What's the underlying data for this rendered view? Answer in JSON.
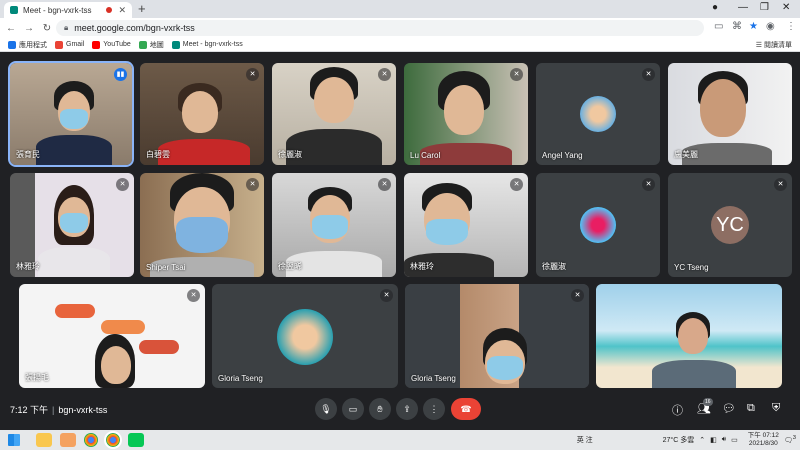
{
  "browser": {
    "tab_title": "Meet - bgn-vxrk-tss",
    "url": "meet.google.com/bgn-vxrk-tss",
    "new_tab_label": "+",
    "bookmarks": [
      {
        "label": "應用程式",
        "icon": "apps-grid-icon",
        "color": "#1a73e8"
      },
      {
        "label": "Gmail",
        "icon": "gmail-icon",
        "color": "#ea4335"
      },
      {
        "label": "YouTube",
        "icon": "youtube-icon",
        "color": "#ff0000"
      },
      {
        "label": "地圖",
        "icon": "maps-icon",
        "color": "#34a853"
      },
      {
        "label": "Meet - bgn-vxrk-tss",
        "icon": "meet-icon",
        "color": "#00897b"
      }
    ],
    "reading_list": "閱讀清單"
  },
  "tiles": [
    {
      "name": "張育民",
      "muted": false,
      "speaking": true
    },
    {
      "name": "白碧雲",
      "muted": true
    },
    {
      "name": "徐麗淑",
      "muted": true
    },
    {
      "name": "Lu Carol",
      "muted": true
    },
    {
      "name": "Angel Yang",
      "muted": true,
      "type": "avatar-photo"
    },
    {
      "name": "盧美麗",
      "muted": false
    },
    {
      "name": "林雅玲",
      "muted": true
    },
    {
      "name": "Shiper Tsai",
      "muted": true
    },
    {
      "name": "徐翌晞",
      "muted": true
    },
    {
      "name": "林雅玲",
      "muted": true
    },
    {
      "name": "徐麗淑",
      "muted": true,
      "type": "avatar-photo"
    },
    {
      "name": "YC Tseng",
      "muted": true,
      "type": "avatar-letter",
      "initials": "YC"
    },
    {
      "name": "張揚毛",
      "muted": true
    },
    {
      "name": "Gloria Tseng",
      "muted": true,
      "type": "avatar-photo"
    },
    {
      "name": "Gloria Tseng",
      "muted": true
    },
    {
      "name": "",
      "muted": false
    }
  ],
  "meeting": {
    "time": "7:12 下午",
    "separator": "|",
    "code": "bgn-vxrk-tss",
    "participant_count": "16"
  },
  "controls": [
    "mic-icon",
    "camera-icon",
    "raise-hand-icon",
    "present-icon",
    "more-icon",
    "hang-up-icon"
  ],
  "side_controls": [
    "info-icon",
    "people-icon",
    "chat-icon",
    "activities-icon",
    "host-controls-icon"
  ],
  "taskbar": {
    "weather": "27°C 多雲",
    "ime": "英 注",
    "time": "下午 07:12",
    "date": "2021/8/30",
    "notif_count": "3"
  },
  "colors": {
    "accent": "#8ab4f8",
    "hangup": "#ea4335",
    "stage": "#202124",
    "tile": "#3c4043"
  }
}
